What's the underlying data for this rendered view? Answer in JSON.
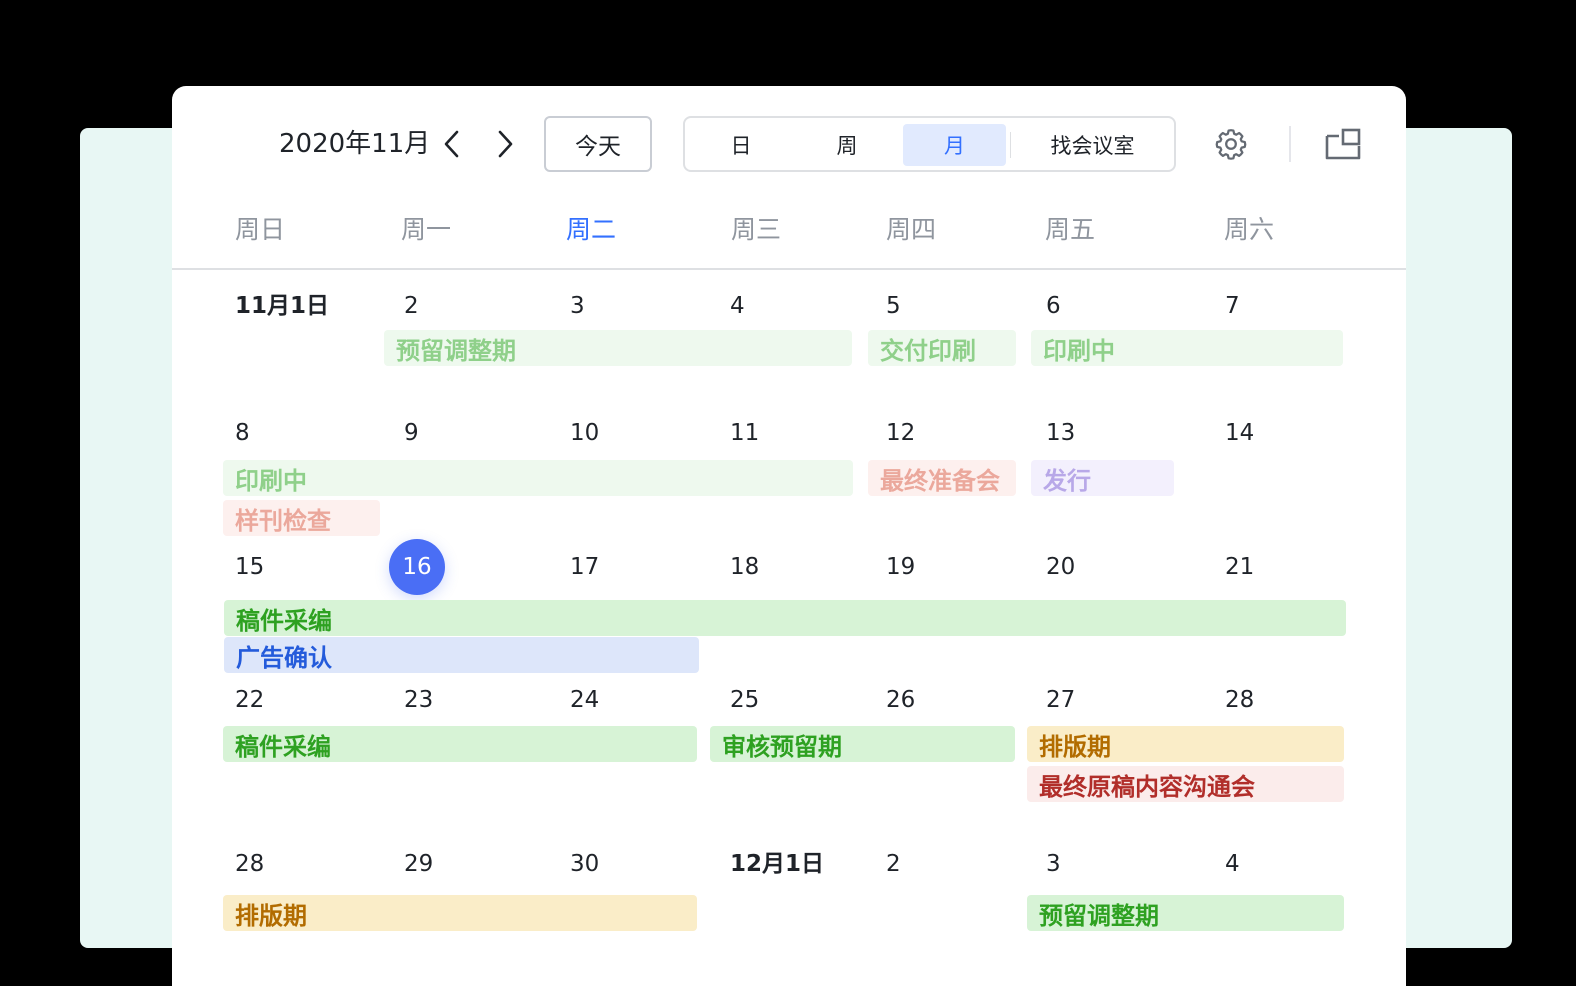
{
  "header": {
    "title": "2020年11月",
    "today_button": "今天",
    "views": [
      "日",
      "周",
      "月",
      "找会议室"
    ],
    "active_view": "月"
  },
  "icons": {
    "prev": "chevron-left-icon",
    "next": "chevron-right-icon",
    "settings": "gear-icon",
    "popout": "popout-window-icon"
  },
  "colors": {
    "accent": "#3370ff",
    "today_circle": "#4a6ef5",
    "backdrop": "#e8f7f4"
  },
  "weekdays": [
    "周日",
    "周一",
    "周二",
    "周三",
    "周四",
    "周五",
    "周六"
  ],
  "today_weekday": "周二",
  "weeks": [
    {
      "days": [
        "11月1日",
        "2",
        "3",
        "4",
        "5",
        "6",
        "7"
      ],
      "events": [
        {
          "title": "预留调整期",
          "style": "green-past"
        },
        {
          "title": "交付印刷",
          "style": "green-past"
        },
        {
          "title": "印刷中",
          "style": "green-past"
        }
      ]
    },
    {
      "days": [
        "8",
        "9",
        "10",
        "11",
        "12",
        "13",
        "14"
      ],
      "events": [
        {
          "title": "印刷中",
          "style": "green-past"
        },
        {
          "title": "最终准备会",
          "style": "red-past"
        },
        {
          "title": "发行",
          "style": "purple-past"
        },
        {
          "title": "样刊检查",
          "style": "red-past"
        }
      ]
    },
    {
      "days": [
        "15",
        "16",
        "17",
        "18",
        "19",
        "20",
        "21"
      ],
      "today": "16",
      "events": [
        {
          "title": "稿件采编",
          "style": "green"
        },
        {
          "title": "广告确认",
          "style": "blue"
        }
      ]
    },
    {
      "days": [
        "22",
        "23",
        "24",
        "25",
        "26",
        "27",
        "28"
      ],
      "events": [
        {
          "title": "稿件采编",
          "style": "green"
        },
        {
          "title": "审核预留期",
          "style": "green"
        },
        {
          "title": "排版期",
          "style": "orange"
        },
        {
          "title": "最终原稿内容沟通会",
          "style": "red"
        }
      ]
    },
    {
      "days": [
        "28",
        "29",
        "30",
        "12月1日",
        "2",
        "3",
        "4"
      ],
      "events": [
        {
          "title": "排版期",
          "style": "orange"
        },
        {
          "title": "预留调整期",
          "style": "green"
        }
      ]
    }
  ]
}
